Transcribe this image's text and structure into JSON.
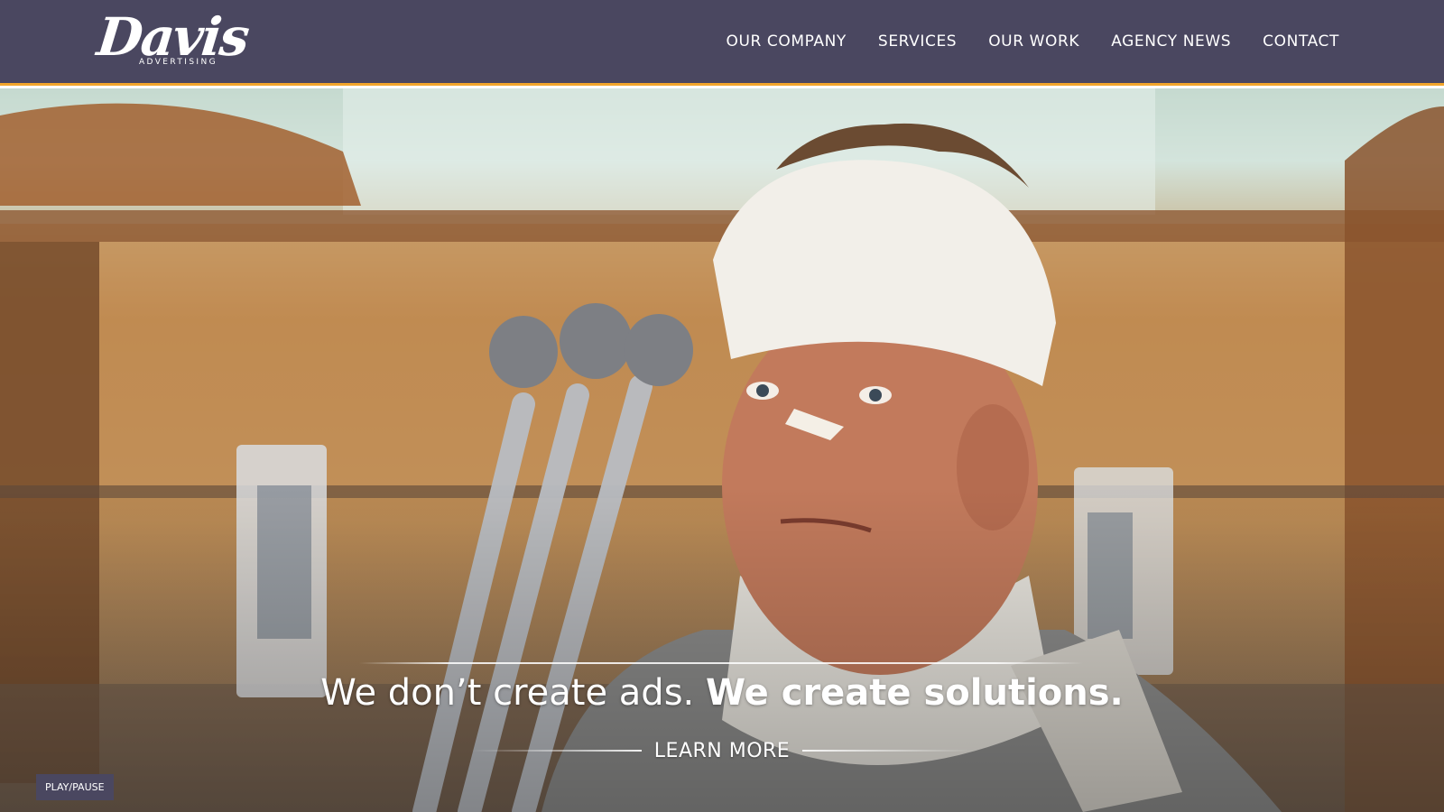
{
  "brand": {
    "name": "Davis",
    "sub": "ADVERTISING"
  },
  "nav": {
    "items": [
      {
        "label": "OUR COMPANY"
      },
      {
        "label": "SERVICES"
      },
      {
        "label": "OUR WORK"
      },
      {
        "label": "AGENCY NEWS"
      },
      {
        "label": "CONTACT"
      }
    ]
  },
  "hero": {
    "tagline_regular": "We don’t create ads.",
    "tagline_bold": "We create solutions.",
    "cta_label": "LEARN MORE"
  },
  "controls": {
    "play_pause_label": "PLAY/PAUSE"
  },
  "colors": {
    "header_bg": "#4a4760",
    "accent": "#f2a62b",
    "text": "#ffffff"
  }
}
